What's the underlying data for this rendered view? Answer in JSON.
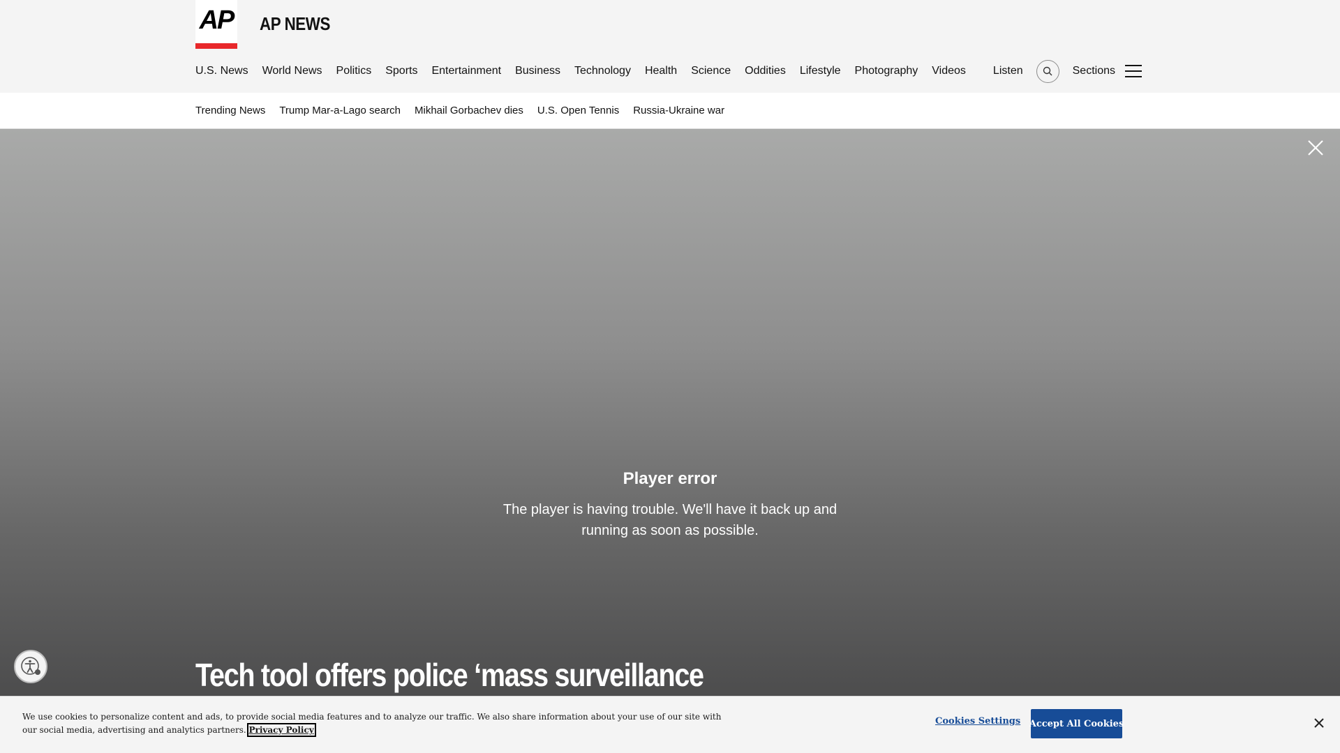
{
  "header": {
    "logo_text": "AP",
    "brand_name": "AP NEWS",
    "colors": {
      "background": "#f4f4f4",
      "logo_accent": "#e8282b"
    },
    "nav_items": [
      {
        "label": "U.S. News"
      },
      {
        "label": "World News"
      },
      {
        "label": "Politics"
      },
      {
        "label": "Sports"
      },
      {
        "label": "Entertainment"
      },
      {
        "label": "Business"
      },
      {
        "label": "Technology"
      },
      {
        "label": "Health"
      },
      {
        "label": "Science"
      },
      {
        "label": "Oddities"
      },
      {
        "label": "Lifestyle"
      },
      {
        "label": "Photography"
      },
      {
        "label": "Videos"
      }
    ],
    "listen_label": "Listen",
    "search_icon": "search-icon",
    "sections_label": "Sections",
    "menu_icon": "hamburger-icon"
  },
  "trending": {
    "items": [
      {
        "label": "Trending News"
      },
      {
        "label": "Trump Mar-a-Lago search"
      },
      {
        "label": "Mikhail Gorbachev dies"
      },
      {
        "label": "U.S. Open Tennis"
      },
      {
        "label": "Russia-Ukraine war"
      }
    ]
  },
  "video": {
    "error_title": "Player error",
    "error_message": "The player is having trouble. We'll have it back up and running as soon as possible.",
    "close_icon": "close-icon"
  },
  "article": {
    "headline": "Tech tool offers police ‘mass surveillance"
  },
  "accessibility": {
    "icon": "accessibility-icon"
  },
  "cookie_banner": {
    "text": "We use cookies to personalize content and ads, to provide social media features and to analyze our traffic. We also share information about your use of our site with our social media, advertising and analytics partners.",
    "privacy_link": "Privacy Policy",
    "settings_label": "Cookies Settings",
    "accept_label": "Accept All Cookies",
    "accent_color": "#174c97"
  }
}
